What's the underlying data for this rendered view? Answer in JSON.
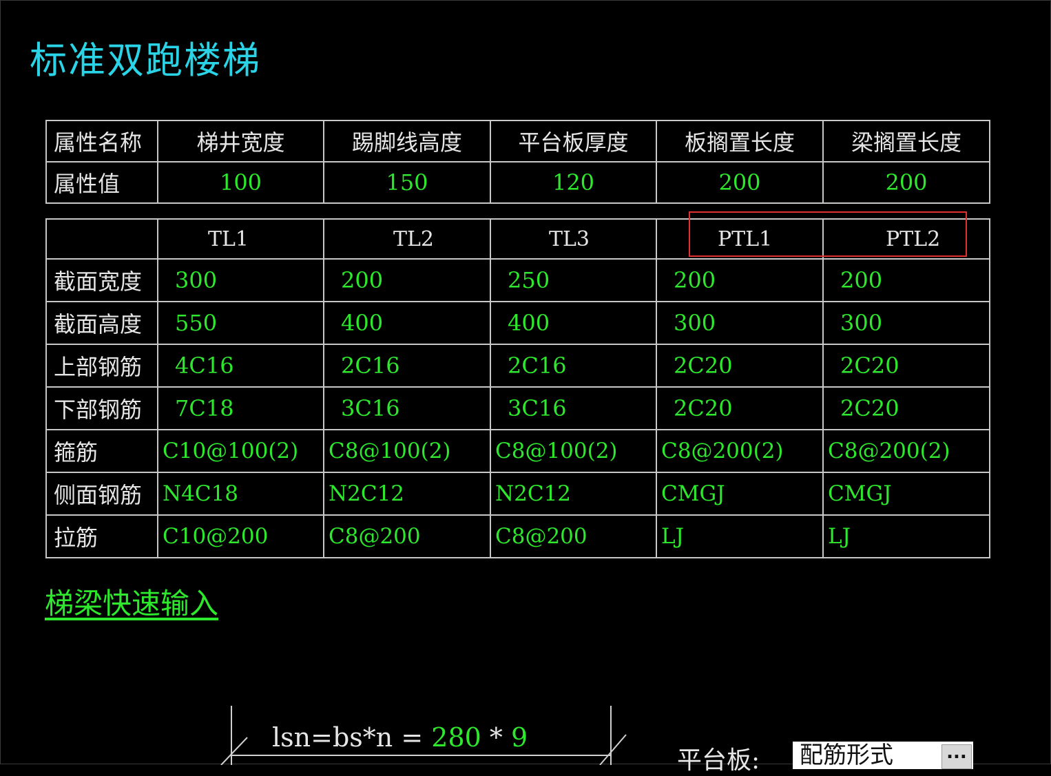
{
  "title": "标准双跑楼梯",
  "props_table": {
    "header_label": "属性名称",
    "value_label": "属性值",
    "columns": [
      "梯井宽度",
      "踢脚线高度",
      "平台板厚度",
      "板搁置长度",
      "梁搁置长度"
    ],
    "values": [
      "100",
      "150",
      "120",
      "200",
      "200"
    ]
  },
  "beam_table": {
    "beams": [
      "TL1",
      "TL2",
      "TL3",
      "PTL1",
      "PTL2"
    ],
    "rows": [
      {
        "label": "截面宽度",
        "values": [
          "300",
          "200",
          "250",
          "200",
          "200"
        ]
      },
      {
        "label": "截面高度",
        "values": [
          "550",
          "400",
          "400",
          "300",
          "300"
        ]
      },
      {
        "label": "上部钢筋",
        "values": [
          "4C16",
          "2C16",
          "2C16",
          "2C20",
          "2C20"
        ]
      },
      {
        "label": "下部钢筋",
        "values": [
          "7C18",
          "3C16",
          "3C16",
          "2C20",
          "2C20"
        ]
      },
      {
        "label": "箍筋",
        "values": [
          "C10@100(2)",
          "C8@100(2)",
          "C8@100(2)",
          "C8@200(2)",
          "C8@200(2)"
        ]
      },
      {
        "label": "侧面钢筋",
        "values": [
          "N4C18",
          "N2C12",
          "N2C12",
          "CMGJ",
          "CMGJ"
        ]
      },
      {
        "label": "拉筋",
        "values": [
          "C10@200",
          "C8@200",
          "C8@200",
          "LJ",
          "LJ"
        ]
      }
    ]
  },
  "quick_input_link": "梯梁快速输入",
  "dimension": {
    "formula_prefix": "lsn=bs*n = ",
    "bs": "280",
    "times": " * ",
    "n": "9"
  },
  "platform": {
    "label": "平台板:",
    "combo_value": "配筋形式",
    "combo_button": "..."
  },
  "colors": {
    "title": "#2ad4e6",
    "value_green": "#2ee82e",
    "highlight_red": "#e03030",
    "background": "#000000"
  }
}
